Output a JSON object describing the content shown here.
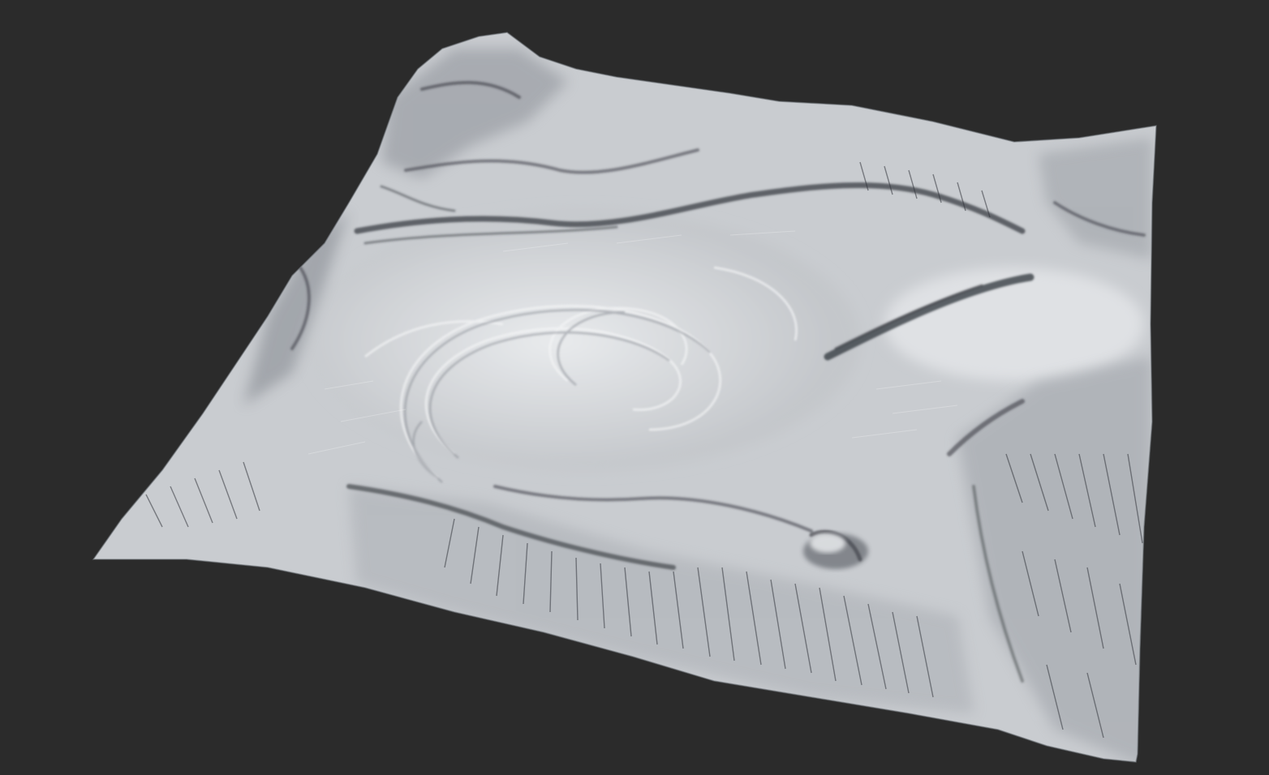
{
  "scene": {
    "background_color": "#2b2b2b",
    "terrain_base_color": "#c9ccd0",
    "terrain_highlight_color": "#e6e8ea",
    "terrain_shadow_color": "#2f3238",
    "subject": "heightfield-terrain-render"
  }
}
